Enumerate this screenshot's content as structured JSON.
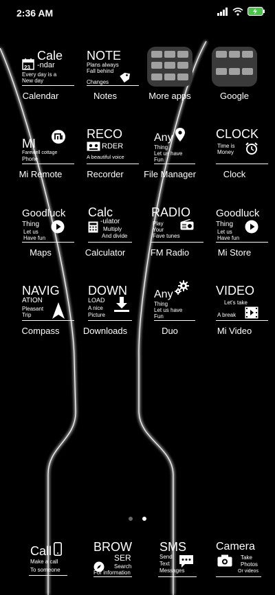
{
  "status": {
    "time": "2:36 AM"
  },
  "apps": [
    {
      "id": "calendar",
      "label": "Calendar",
      "title1": "Cale",
      "title2": "-ndar",
      "sub": "Every day is a",
      "sub2": "New day",
      "date": "23"
    },
    {
      "id": "notes",
      "label": "Notes",
      "title1": "NOTE",
      "sub": "Plans always",
      "sub2": "Fall behind",
      "sub3": "Changes"
    },
    {
      "id": "more-apps",
      "label": "More apps"
    },
    {
      "id": "google",
      "label": "Google"
    },
    {
      "id": "mi-remote",
      "label": "Mi Remote",
      "title1": "MI",
      "sub": "Farewell cottage",
      "sub2": "Phone"
    },
    {
      "id": "recorder",
      "label": "Recorder",
      "title1": "RECO",
      "title2": "RDER",
      "sub": "A beautiful voice"
    },
    {
      "id": "file-manager",
      "label": "File Manager",
      "title1": "Any",
      "sub": "Thing",
      "sub2": "Let us have",
      "sub3": "Fun"
    },
    {
      "id": "clock",
      "label": "Clock",
      "title1": "CLOCK",
      "sub": "Time is",
      "sub2": "Money"
    },
    {
      "id": "maps",
      "label": "Maps",
      "title1": "Goodluck",
      "sub": "Thing",
      "sub2": "Let us",
      "sub3": "Have fun"
    },
    {
      "id": "calculator",
      "label": "Calculator",
      "title1": "Calc",
      "title2": "-ulator",
      "sub": "Multiply",
      "sub2": "And divide"
    },
    {
      "id": "fm-radio",
      "label": "FM Radio",
      "title1": "RADIO",
      "sub": "Play",
      "sub2": "Your",
      "sub3": "Fave tunes"
    },
    {
      "id": "mi-store",
      "label": "Mi Store",
      "title1": "Goodluck",
      "sub": "Thing",
      "sub2": "Let us",
      "sub3": "Have fun"
    },
    {
      "id": "compass",
      "label": "Compass",
      "title1": "NAVIG",
      "title2": "ATION",
      "sub": "Pleasant",
      "sub2": "Trip"
    },
    {
      "id": "downloads",
      "label": "Downloads",
      "title1": "DOWN",
      "title2": "LOAD",
      "sub": "A nice",
      "sub2": "Picture"
    },
    {
      "id": "duo",
      "label": "Duo",
      "title1": "Any",
      "sub": "Thing",
      "sub2": "Let us have",
      "sub3": "Fun"
    },
    {
      "id": "mi-video",
      "label": "Mi Video",
      "title1": "VIDEO",
      "sub": "Let's take",
      "sub2": "A break"
    }
  ],
  "dock": [
    {
      "id": "phone",
      "title1": "Call",
      "sub": "Make a call",
      "sub2": "To someone"
    },
    {
      "id": "browser",
      "title1": "BROW",
      "title2": "SER",
      "sub": "Search",
      "sub2": "For information"
    },
    {
      "id": "messages",
      "title1": "SMS",
      "sub": "Send",
      "sub2": "Text",
      "sub3": "Messages"
    },
    {
      "id": "camera",
      "title1": "Camera",
      "sub": "Take",
      "sub2": "Photos",
      "sub3": "Or videos"
    }
  ],
  "page_indicator": {
    "pages": 2,
    "current": 2
  }
}
